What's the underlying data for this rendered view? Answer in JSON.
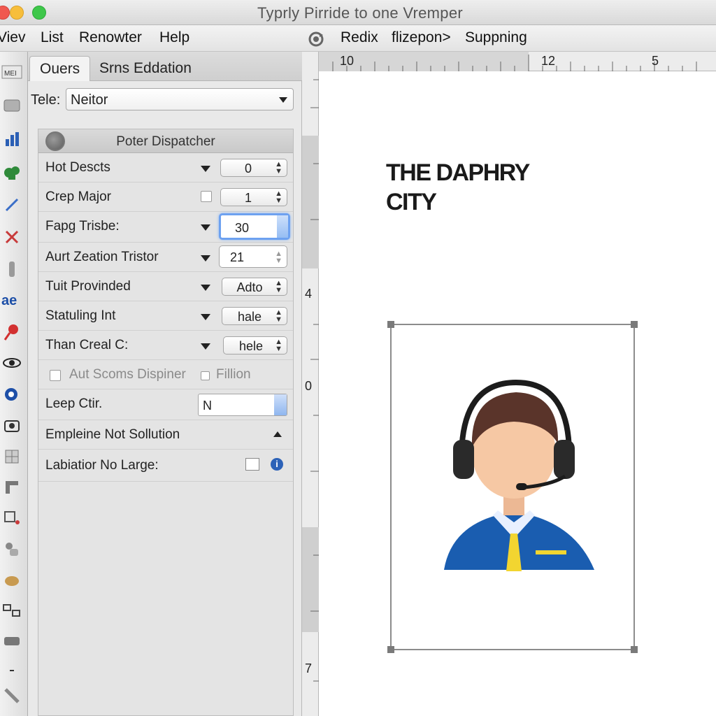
{
  "window": {
    "title": "Typrly Pirride to one Vremper"
  },
  "menubar": {
    "left_items": [
      "Viev",
      "List",
      "Renowter",
      "Help"
    ],
    "right_items": [
      "Redix",
      "flizepon>",
      "Suppning"
    ]
  },
  "panel": {
    "tabs": [
      "Ouers",
      "Srns Eddation"
    ],
    "tele": {
      "label": "Tele:",
      "value": "Neitor"
    },
    "group_title": "Poter Dispatcher",
    "rows": [
      {
        "label": "Hot Descts",
        "value": "0"
      },
      {
        "label": "Crep Major",
        "value": "1"
      },
      {
        "label": "Fapg Trisbe:",
        "value": "30"
      },
      {
        "label": "Aurt Zeation Tristor",
        "value": "21"
      },
      {
        "label": "Tuit Provinded",
        "value": "Adto"
      },
      {
        "label": "Statuling Int",
        "value": "hale"
      },
      {
        "label": "Than Creal C:",
        "value": "hele"
      }
    ],
    "checkbox_row": {
      "label": "Aut Scoms Dispiner",
      "label2": "Fillion"
    },
    "leep": {
      "label": "Leep Ctir.",
      "value": "N"
    },
    "emp_row": {
      "label": "Empleine Not Sollution"
    },
    "lab_row": {
      "label": "Labiatior No Large:"
    }
  },
  "ruler": {
    "top": [
      "10",
      "12",
      "5"
    ],
    "left": [
      "4",
      "0",
      "7"
    ]
  },
  "canvas": {
    "headline_line1": "THE DAPHRY",
    "headline_line2": "CITY"
  },
  "colors": {
    "shirt": "#1a5db0",
    "tie": "#f2d530",
    "skin": "#f6c8a4",
    "hair": "#5a342a"
  },
  "icons": {
    "toolstrip": [
      "menu-icon",
      "cube-icon",
      "bar-chart-icon",
      "puzzle-icon",
      "pen-icon",
      "scissors-icon",
      "bottle-icon",
      "text-tool-icon",
      "paint-brush-icon",
      "eye-icon",
      "zoom-icon",
      "camera-icon",
      "grid-icon",
      "frame-icon",
      "layers-icon",
      "mug-icon",
      "bucket-icon",
      "connect-icon",
      "tray-icon",
      "dash-icon",
      "wrench-icon"
    ]
  }
}
